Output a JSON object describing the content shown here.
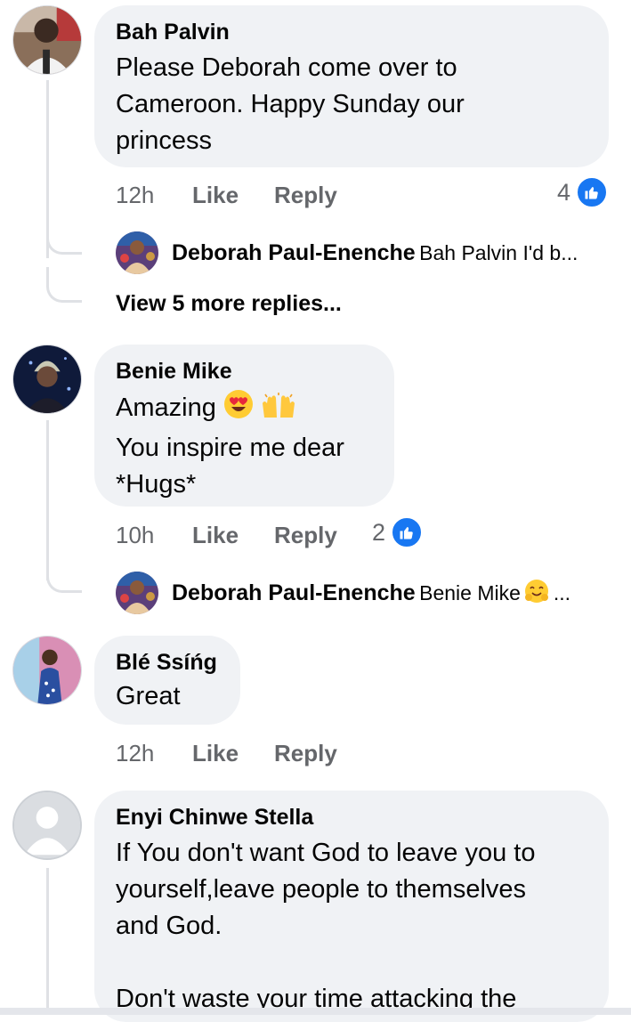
{
  "colors": {
    "like_blue": "#1877f2",
    "bubble": "#f0f2f5",
    "meta_gray": "#65676b",
    "thread_line": "#dfe1e5"
  },
  "comments": [
    {
      "author": "Bah Palvin",
      "text": "Please Deborah come over to Cameroon. Happy Sunday our princess",
      "time": "12h",
      "like": "Like",
      "reply": "Reply",
      "reaction_count": "4",
      "reaction_icon": "thumbs-up-icon",
      "replies": [
        {
          "author": "Deborah Paul-Enenche",
          "preview": "Bah Palvin I'd b..."
        }
      ],
      "more_replies": "View 5 more replies..."
    },
    {
      "author": "Benie Mike",
      "text_line1": "Amazing",
      "text_line2": "You inspire me dear",
      "text_line3": "*Hugs*",
      "emojis": [
        "heart-eyes-emoji",
        "raising-hands-emoji"
      ],
      "time": "10h",
      "like": "Like",
      "reply": "Reply",
      "reaction_count": "2",
      "reaction_icon": "thumbs-up-icon",
      "replies": [
        {
          "author": "Deborah Paul-Enenche",
          "preview": "Benie Mike",
          "preview_suffix": "..."
        }
      ]
    },
    {
      "author": "Blé Ssíńg",
      "text": "Great",
      "time": "12h",
      "like": "Like",
      "reply": "Reply"
    },
    {
      "author": "Enyi Chinwe Stella",
      "text_line1": "If You don't want God to leave you to",
      "text_line2": "yourself,leave people to themselves",
      "text_line3": "and God.",
      "text_line4": "Don't waste your time attacking the"
    }
  ]
}
